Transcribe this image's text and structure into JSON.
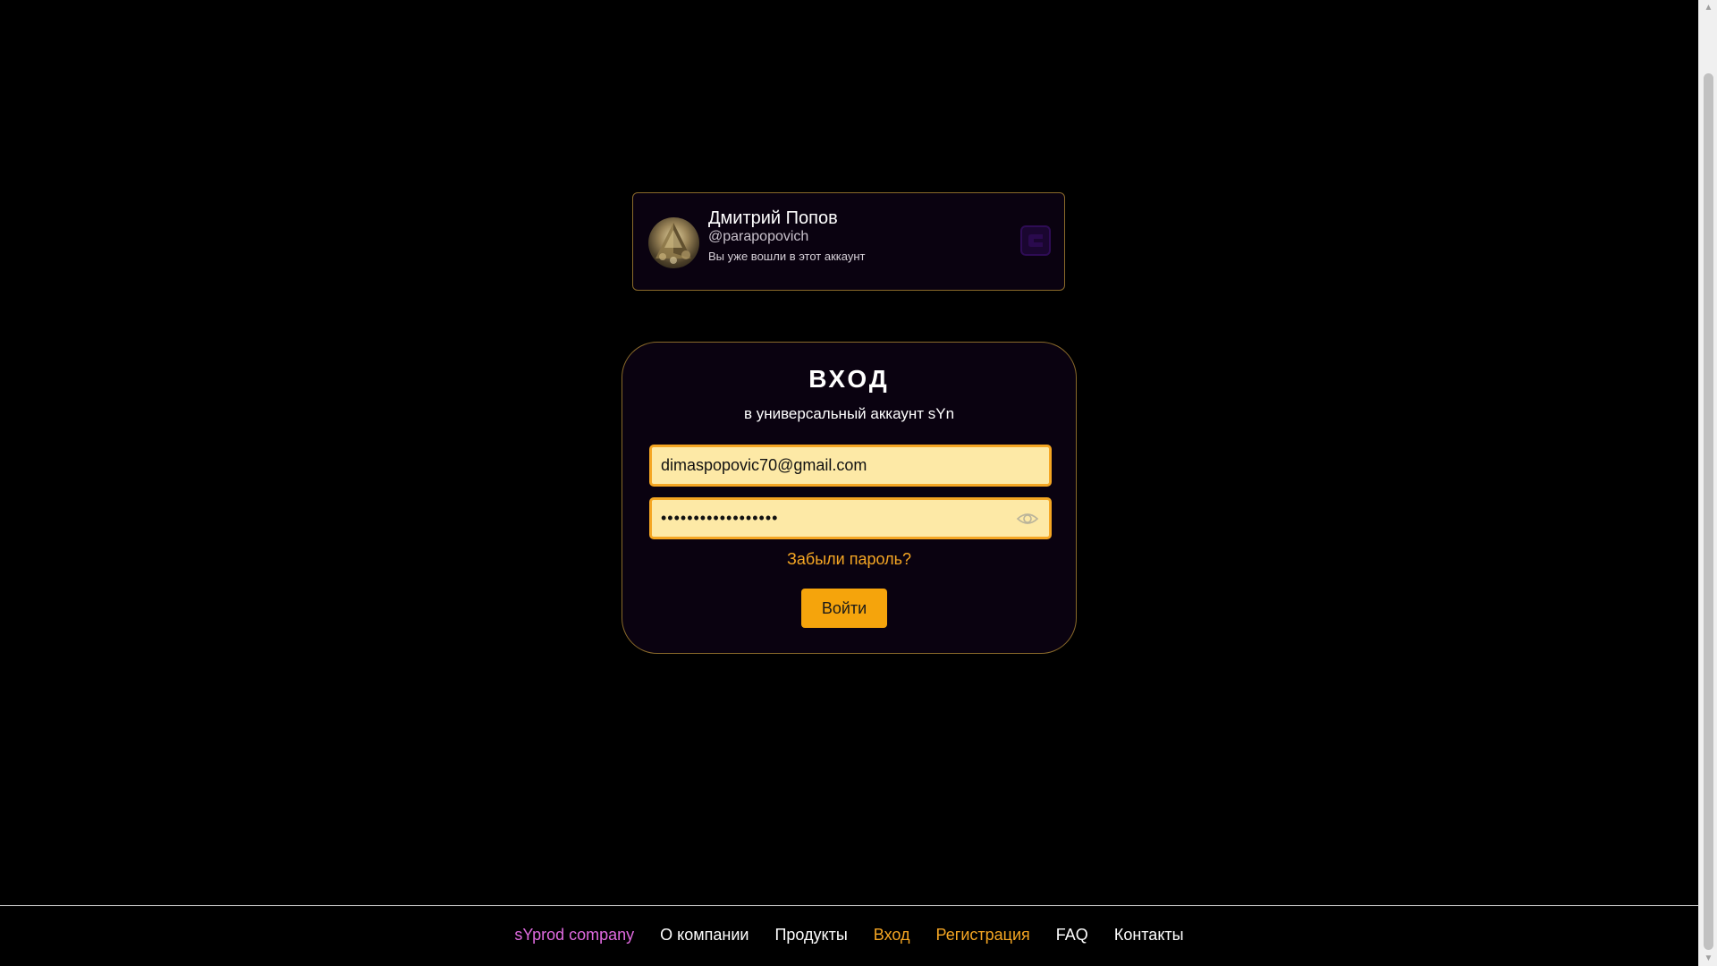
{
  "account": {
    "name": "Дмитрий Попов",
    "handle": "@parapopovich",
    "status": "Вы уже вошли в этот аккаунт",
    "avatar_icon": "avatar-pyramid-image",
    "brand_icon": "syn-logo-icon"
  },
  "login": {
    "title": "ВХОД",
    "subtitle": "в универсальный аккаунт sYn",
    "email_value": "dimaspopovic70@gmail.com",
    "password_value": "••••••••••••••••••",
    "password_toggle_icon": "eye-icon",
    "forgot_label": "Забыли пароль?",
    "submit_label": "Войти"
  },
  "footer": {
    "links": [
      {
        "label": "sYprod company"
      },
      {
        "label": "О компании"
      },
      {
        "label": "Продукты"
      },
      {
        "label": "Вход"
      },
      {
        "label": "Регистрация"
      },
      {
        "label": "FAQ"
      },
      {
        "label": "Контакты"
      }
    ]
  },
  "colors": {
    "background": "#000000",
    "card_background": "#0a0210",
    "card_border": "#8a6a2a",
    "accent": "#f5a623",
    "input_fill": "#fde9a6",
    "brand_link": "#e06ae0"
  }
}
